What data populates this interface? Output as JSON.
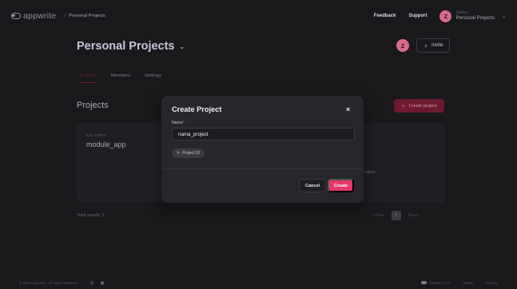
{
  "header": {
    "logo_text": "appwrite",
    "crumb_separator": "/",
    "breadcrumb": "Personal Projects",
    "links": [
      "Feedback",
      "Support"
    ],
    "account": {
      "avatar_initial": "Z",
      "name": "Zaidan",
      "org": "Personal Projects"
    }
  },
  "org": {
    "title": "Personal Projects",
    "avatar_initial": "Z",
    "invite_label": "Invite"
  },
  "tabs": [
    "Projects",
    "Members",
    "Settings"
  ],
  "projects": {
    "title": "Projects",
    "create_label": "Create project",
    "card": {
      "label": "NO APPS",
      "name": "module_app"
    },
    "second_card_fragment": "roject",
    "total": "Total results: 1",
    "pager": {
      "prev": "Prev",
      "page": "1",
      "next": "Next"
    }
  },
  "footer": {
    "copyright": "© 2023 Appwrite. All rights reserved.",
    "version": "Version 1.3.7",
    "terms": "Terms",
    "privacy": "Privacy"
  },
  "modal": {
    "title": "Create Project",
    "close": "×",
    "name_label": "Name",
    "name_required": "*",
    "name_value": "nama_project",
    "project_id_label": "Project ID",
    "cancel_label": "Cancel",
    "create_label": "Create"
  },
  "colors": {
    "background": "#19191c",
    "accent": "#e5386a",
    "accent_dim": "#6d1a30"
  }
}
